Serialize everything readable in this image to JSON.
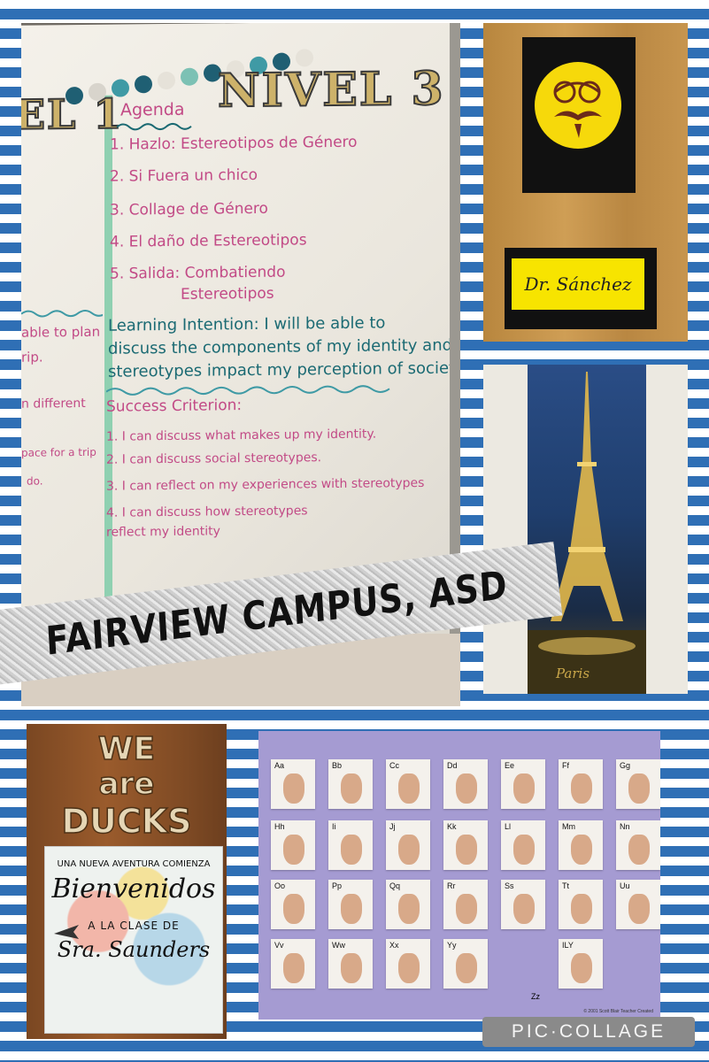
{
  "whiteboard": {
    "title_left": "EL 1",
    "title_right": "NIVEL 3",
    "agenda_heading": "Agenda",
    "agenda_items": [
      "1. Hazlo: Estereotipos de Género",
      "2. Si Fuera un chico",
      "3. Collage de Género",
      "4. El daño de Estereotipos",
      "5. Salida: Combatiendo",
      "Estereotipos"
    ],
    "learning_intention": [
      "Learning Intention: I will be able to",
      "discuss the components of my identity and how",
      "stereotypes impact my perception of society"
    ],
    "success_heading": "Success Criterion:",
    "success_items": [
      "1. I can discuss what makes up my identity.",
      "2. I can discuss social stereotypes.",
      "3. I can reflect on my experiences with stereotypes",
      "4. I can discuss how stereotypes",
      "reflect my identity"
    ],
    "left_fragments": [
      "able to plan",
      "rip.",
      "n different",
      "pace for a trip",
      "do."
    ]
  },
  "door": {
    "nameplate": "Dr. Sánchez"
  },
  "eiffel": {
    "caption": "Paris"
  },
  "banner": {
    "text": "FAIRVIEW CAMPUS, ASD"
  },
  "ducks": {
    "words": [
      "WE",
      "are",
      "DUCKS"
    ],
    "sign_line1": "UNA NUEVA AVENTURA COMIENZA",
    "sign_line2": "Bienvenidos",
    "sign_line3": "A LA CLASE DE",
    "sign_line4": "Sra. Saunders"
  },
  "asl": {
    "letters": [
      "Aa",
      "Bb",
      "Cc",
      "Dd",
      "Ee",
      "Ff",
      "Gg",
      "Hh",
      "Ii",
      "Jj",
      "Kk",
      "Ll",
      "Mm",
      "Nn",
      "Oo",
      "Pp",
      "Qq",
      "Rr",
      "Ss",
      "Tt",
      "Uu",
      "Vv",
      "Ww",
      "Xx",
      "Yy",
      "Zz",
      "ILY"
    ],
    "copyright": "© 2001 Scott Blair Teacher Created"
  },
  "watermark": "PIC·COLLAGE",
  "colors": {
    "stripe_blue": "#2f6fb5",
    "marker_pink": "#c24a86",
    "marker_teal": "#1b6a73",
    "smiley_yellow": "#f6d90b",
    "poster_purple": "#a59bd2"
  }
}
